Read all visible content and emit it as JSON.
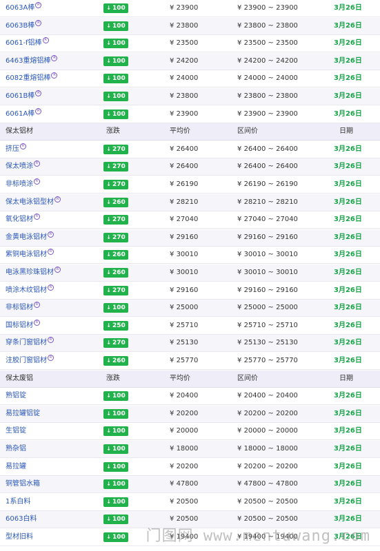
{
  "headers": {
    "change": "涨跌",
    "avg": "平均价",
    "range": "区间价",
    "date": "日期"
  },
  "currency": "¥",
  "arrow": "↓",
  "badge_color": "#22b24c",
  "date_color": "#1aa34a",
  "link_color": "#2a57b8",
  "rows": [
    {
      "type": "item",
      "name": "6063A棒",
      "sup": true,
      "change": "100",
      "avg": "23900",
      "range": "23900 ~ 23900",
      "date": "3月26日"
    },
    {
      "type": "item",
      "name": "6063B棒",
      "sup": true,
      "change": "100",
      "avg": "23800",
      "range": "23800 ~ 23800",
      "date": "3月26日"
    },
    {
      "type": "item",
      "name": "6061-f铝棒",
      "sup": true,
      "change": "100",
      "avg": "23500",
      "range": "23500 ~ 23500",
      "date": "3月26日"
    },
    {
      "type": "item",
      "name": "6463重熔铝棒",
      "sup": true,
      "change": "100",
      "avg": "24200",
      "range": "24200 ~ 24200",
      "date": "3月26日"
    },
    {
      "type": "item",
      "name": "6082重熔铝棒",
      "sup": true,
      "change": "100",
      "avg": "24000",
      "range": "24000 ~ 24000",
      "date": "3月26日"
    },
    {
      "type": "item",
      "name": "6061B棒",
      "sup": true,
      "change": "100",
      "avg": "23800",
      "range": "23800 ~ 23800",
      "date": "3月26日"
    },
    {
      "type": "item",
      "name": "6061A棒",
      "sup": true,
      "change": "100",
      "avg": "23900",
      "range": "23900 ~ 23900",
      "date": "3月26日"
    },
    {
      "type": "head",
      "name": "保太铝材"
    },
    {
      "type": "item",
      "name": "挤压",
      "sup": true,
      "change": "270",
      "avg": "26400",
      "range": "26400 ~ 26400",
      "date": "3月26日"
    },
    {
      "type": "item",
      "name": "保太喷涂",
      "sup": true,
      "change": "270",
      "avg": "26400",
      "range": "26400 ~ 26400",
      "date": "3月26日"
    },
    {
      "type": "item",
      "name": "非标喷涂",
      "sup": true,
      "change": "270",
      "avg": "26190",
      "range": "26190 ~ 26190",
      "date": "3月26日"
    },
    {
      "type": "item",
      "name": "保太电泳铝型材",
      "sup": true,
      "change": "260",
      "avg": "28210",
      "range": "28210 ~ 28210",
      "date": "3月26日"
    },
    {
      "type": "item",
      "name": "氧化铝材",
      "sup": true,
      "change": "270",
      "avg": "27040",
      "range": "27040 ~ 27040",
      "date": "3月26日"
    },
    {
      "type": "item",
      "name": "金黄电泳铝材",
      "sup": true,
      "change": "270",
      "avg": "29160",
      "range": "29160 ~ 29160",
      "date": "3月26日"
    },
    {
      "type": "item",
      "name": "紫铜电泳铝材",
      "sup": true,
      "change": "260",
      "avg": "30010",
      "range": "30010 ~ 30010",
      "date": "3月26日"
    },
    {
      "type": "item",
      "name": "电泳黑珍珠铝材",
      "sup": true,
      "change": "260",
      "avg": "30010",
      "range": "30010 ~ 30010",
      "date": "3月26日"
    },
    {
      "type": "item",
      "name": "喷涂木纹铝材",
      "sup": true,
      "change": "270",
      "avg": "29160",
      "range": "29160 ~ 29160",
      "date": "3月26日"
    },
    {
      "type": "item",
      "name": "非标铝材",
      "sup": true,
      "change": "100",
      "avg": "25000",
      "range": "25000 ~ 25000",
      "date": "3月26日"
    },
    {
      "type": "item",
      "name": "国标铝材",
      "sup": true,
      "change": "250",
      "avg": "25710",
      "range": "25710 ~ 25710",
      "date": "3月26日"
    },
    {
      "type": "item",
      "name": "穿条门窗铝材",
      "sup": true,
      "change": "270",
      "avg": "25130",
      "range": "25130 ~ 25130",
      "date": "3月26日"
    },
    {
      "type": "item",
      "name": "注胶门窗铝材",
      "sup": true,
      "change": "260",
      "avg": "25770",
      "range": "25770 ~ 25770",
      "date": "3月26日"
    },
    {
      "type": "head",
      "name": "保太废铝"
    },
    {
      "type": "item",
      "name": "熟铝锭",
      "sup": false,
      "change": "100",
      "avg": "20400",
      "range": "20400 ~ 20400",
      "date": "3月26日"
    },
    {
      "type": "item",
      "name": "易拉罐铝锭",
      "sup": false,
      "change": "100",
      "avg": "20200",
      "range": "20200 ~ 20200",
      "date": "3月26日"
    },
    {
      "type": "item",
      "name": "生铝锭",
      "sup": false,
      "change": "100",
      "avg": "20000",
      "range": "20000 ~ 20000",
      "date": "3月26日"
    },
    {
      "type": "item",
      "name": "熟杂铝",
      "sup": false,
      "change": "100",
      "avg": "18000",
      "range": "18000 ~ 18000",
      "date": "3月26日"
    },
    {
      "type": "item",
      "name": "易拉罐",
      "sup": false,
      "change": "100",
      "avg": "20200",
      "range": "20200 ~ 20200",
      "date": "3月26日"
    },
    {
      "type": "item",
      "name": "铜管铝水箱",
      "sup": false,
      "change": "100",
      "avg": "47800",
      "range": "47800 ~ 47800",
      "date": "3月26日"
    },
    {
      "type": "item",
      "name": "1系白料",
      "sup": false,
      "change": "100",
      "avg": "20500",
      "range": "20500 ~ 20500",
      "date": "3月26日"
    },
    {
      "type": "item",
      "name": "6063白料",
      "sup": false,
      "change": "100",
      "avg": "20500",
      "range": "20500 ~ 20500",
      "date": "3月26日"
    },
    {
      "type": "item",
      "name": "型材旧料",
      "sup": false,
      "change": "100",
      "avg": "19400",
      "range": "19400 ~ 19400",
      "date": "3月26日"
    }
  ],
  "watermark": "门图网 www.mentuwang.com"
}
